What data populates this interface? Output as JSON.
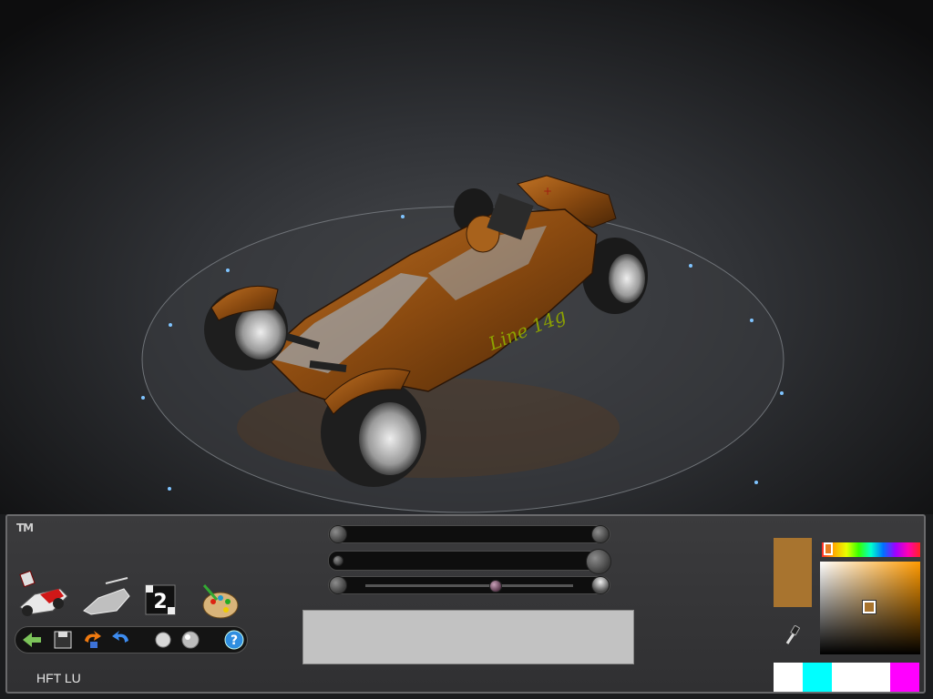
{
  "car_name": "HFT LU",
  "livery_text": "Line 14g",
  "logo_text": "TM",
  "colors": {
    "car_body": "#8a4a10",
    "current_color": "#a8742f",
    "palette": [
      "#ffffff",
      "#00ffff",
      "#ffffff",
      "#ffffff",
      "#ff00ff"
    ]
  },
  "sliders": [
    {
      "name": "slider-1",
      "value": 0.0
    },
    {
      "name": "slider-2",
      "value": 1.0
    },
    {
      "name": "slider-3",
      "value": 0.58
    }
  ],
  "icons": {
    "paint_tools": [
      "paint-car-icon",
      "sketch-car-icon",
      "number-decal-icon",
      "palette-icon"
    ],
    "toolbar": [
      "back-icon",
      "save-icon",
      "undo-icon",
      "redo-icon",
      "brush-small-icon",
      "brush-large-icon",
      "help-icon"
    ]
  },
  "decal_number": "2"
}
